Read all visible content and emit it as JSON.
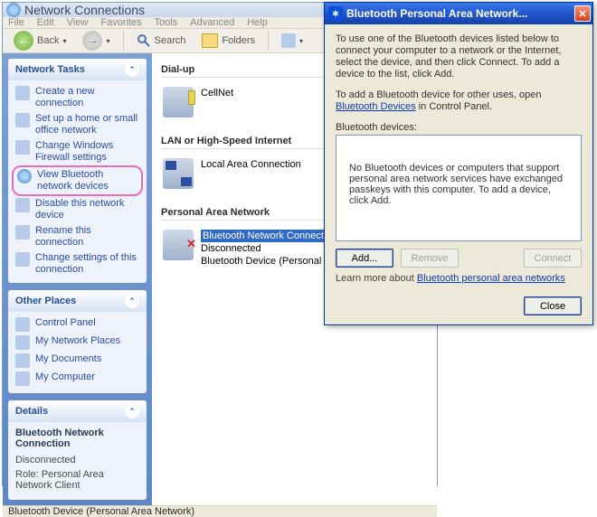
{
  "window": {
    "title": "Network Connections"
  },
  "menu": {
    "file": "File",
    "edit": "Edit",
    "view": "View",
    "favorites": "Favorites",
    "tools": "Tools",
    "advanced": "Advanced",
    "help": "Help"
  },
  "toolbar": {
    "back": "Back",
    "search": "Search",
    "folders": "Folders"
  },
  "sidebar": {
    "tasks_header": "Network Tasks",
    "tasks": [
      "Create a new connection",
      "Set up a home or small office network",
      "Change Windows Firewall settings",
      "View Bluetooth network devices",
      "Disable this network device",
      "Rename this connection",
      "Change settings of this connection"
    ],
    "places_header": "Other Places",
    "places": [
      "Control Panel",
      "My Network Places",
      "My Documents",
      "My Computer"
    ],
    "details_header": "Details",
    "details": {
      "title": "Bluetooth Network Connection",
      "status": "Disconnected",
      "role": "Role: Personal Area Network Client"
    }
  },
  "groups": {
    "dialup": {
      "header": "Dial-up",
      "items": [
        {
          "name": "CellNet"
        }
      ]
    },
    "lan": {
      "header": "LAN or High-Speed Internet",
      "items": [
        {
          "name": "Local Area Connection"
        }
      ]
    },
    "pan": {
      "header": "Personal Area Network",
      "items": [
        {
          "name": "Bluetooth Network Connection",
          "status": "Disconnected",
          "device": "Bluetooth Device (Personal Are"
        }
      ]
    }
  },
  "statusbar": "Bluetooth Device (Personal Area Network)",
  "dialog": {
    "title": "Bluetooth Personal Area Network...",
    "intro": "To use one of the Bluetooth devices listed below to connect your computer to a network or the Internet, select the device, and then click Connect. To add a device to the list, click Add.",
    "add_hint_pre": "To add a Bluetooth device for other uses, open ",
    "add_hint_link": "Bluetooth Devices",
    "add_hint_post": " in Control Panel.",
    "list_label": "Bluetooth devices:",
    "empty_msg": "No Bluetooth devices or computers that support personal area network services have exchanged passkeys with this computer. To add a device, click Add.",
    "btn_add": "Add...",
    "btn_remove": "Remove",
    "btn_connect": "Connect",
    "learn_pre": "Learn more about ",
    "learn_link": "Bluetooth personal area networks",
    "btn_close": "Close"
  }
}
